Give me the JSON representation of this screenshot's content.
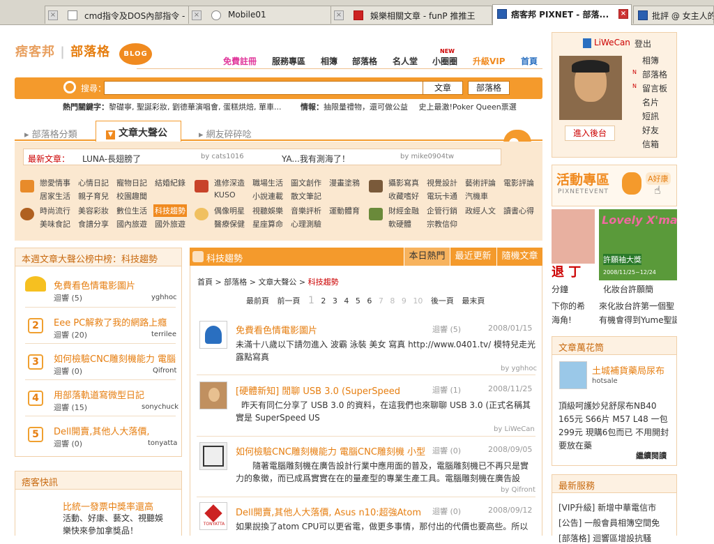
{
  "browser": {
    "tabs": [
      {
        "title": "cmd指令及DOS內部指令 - ..."
      },
      {
        "title": "Mobile01"
      },
      {
        "title": "娛樂相關文章 - funP 推推王"
      },
      {
        "title": "痞客邦 PIXNET - 部落..."
      },
      {
        "title": "批評 @ 女主人的"
      }
    ]
  },
  "header": {
    "logo_a": "痞客邦",
    "logo_b": "部落格",
    "logo_badge": "BLOG",
    "nav": [
      "免費註冊",
      "服務專區",
      "相簿",
      "部落格",
      "名人堂",
      "小圈圈",
      "升級VIP",
      "首頁"
    ],
    "new_badge": "NEW"
  },
  "search": {
    "label": "搜尋：",
    "btn_article": "文章",
    "btn_blog": "部落格",
    "hot_label": "熱門關鍵字：",
    "hot_text": "黎礎寧, 聖誕彩妝, 劉德華演唱會, 蛋糕烘焙, 單車...",
    "info_label": "情報：",
    "info_text": "抽限量禮物，還可做公益",
    "info_text2": "史上最激!Poker Queen票選"
  },
  "tabs2": [
    "部落格分類",
    "文章大聲公",
    "網友碎碎唸"
  ],
  "latest": {
    "label": "最新文章：",
    "item1": "LUNA-長翅膀了",
    "by1": "by cats1016",
    "item2": "YA...我有測海了！",
    "by2": "by mike0904tw"
  },
  "categories": {
    "g1": [
      "戀愛情事",
      "心情日記",
      "寵物日記",
      "結婚紀錄",
      "居家生活",
      "親子育兒",
      "校園趣聞"
    ],
    "g2": [
      "進修深造",
      "職場生活",
      "圖文創作",
      "漫畫塗鴉",
      "KUSO",
      "小說連載",
      "散文筆記"
    ],
    "g3": [
      "攝影寫真",
      "視覺設計",
      "藝術評論",
      "電影評論",
      "收藏嗜好",
      "電玩卡通",
      "汽機車"
    ],
    "g4": [
      "時尚流行",
      "美容彩妝",
      "數位生活",
      "科技趨勢",
      "美味食記",
      "食譜分享",
      "國內旅遊",
      "國外旅遊"
    ],
    "g5": [
      "偶像明星",
      "視聽娛樂",
      "音樂評析",
      "運動體育",
      "醫療保健",
      "星座算命",
      "心理測驗"
    ],
    "g6": [
      "財經金融",
      "企管行銷",
      "政經人文",
      "讀書心得",
      "軟硬體",
      "宗教信仰"
    ]
  },
  "weekly": {
    "title": "本週文章大聲公榜中榜：科技趨勢",
    "items": [
      {
        "rank": "1",
        "title": "免費看色情電影圖片",
        "sub": "迴響 (5)",
        "by": "yghhoc"
      },
      {
        "rank": "2",
        "title": "Eee PC解救了我的網路上癮",
        "sub": "迴響 (20)",
        "by": "terrilee"
      },
      {
        "rank": "3",
        "title": "如何檢驗CNC雕刻機能力 電腦",
        "sub": "迴響 (0)",
        "by": "Qifront"
      },
      {
        "rank": "4",
        "title": "用部落軌道寫微型日記",
        "sub": "迴響 (15)",
        "by": "sonychuck"
      },
      {
        "rank": "5",
        "title": "Dell開賣,其他人大落價,",
        "sub": "迴響 (0)",
        "by": "tonyatta"
      }
    ]
  },
  "quick": {
    "title": "痞客快訊",
    "line1": "比統一發票中獎率還高",
    "line2": "活動、好康、藝文、視聽娛",
    "line3": "樂快來參加拿獎品！"
  },
  "center": {
    "title": "科技趨勢",
    "tabs": [
      "本日熱門",
      "最近更新",
      "隨機文章"
    ],
    "crumb1": "首頁",
    "crumb2": "部落格",
    "crumb3": "文章大聲公",
    "crumb4": "科技趨勢",
    "page_first": "最前頁",
    "page_prev": "前一頁",
    "pages": [
      "1",
      "2",
      "3",
      "4",
      "5",
      "6",
      "7",
      "8",
      "9",
      "10"
    ],
    "page_next": "後一頁",
    "page_last": "最末頁",
    "posts": [
      {
        "title": "免費看色情電影圖片",
        "meta": "迴響 (5)",
        "date": "2008/01/15",
        "body": "未滿十八歲以下請勿進入 波霸 泳裝 美女 寫真 http://www.0401.tv/ 模特兒走光露點寫真",
        "by": "by yghhoc"
      },
      {
        "title": "[硬體新知] 閒聊 USB 3.0 (SuperSpeed",
        "meta": "迴響 (1)",
        "date": "2008/11/25",
        "body": "昨天有同仁分享了 USB 3.0 的資料，在這我們也來聊聊 USB 3.0 (正式名稱其實是 SuperSpeed US",
        "by": "by LiWeCan"
      },
      {
        "title": "如何檢驗CNC雕刻機能力 電腦CNC雕刻機 小型",
        "meta": "迴響 (0)",
        "date": "2008/09/05",
        "body": "隨著電腦雕刻機在廣告設計行業中應用面的普及，電腦雕刻機已不再只是實力的象徵，而已成爲實實在在的量產型的專業生產工具。電腦雕刻機在廣告設",
        "by": "by Qifront"
      },
      {
        "title": "Dell開賣,其他人大落價, Asus n10:超強Atom",
        "meta": "迴響 (0)",
        "date": "2008/09/12",
        "body": "如果說換了atom CPU可以更省電，做更多事情，那付出的代價也要高些。所以",
        "by": ""
      }
    ],
    "thumb4_label": "TONYATTA"
  },
  "user": {
    "name": "LiWeCan",
    "logout": "登出",
    "links": [
      "相簿",
      "部落格",
      "留言板",
      "名片",
      "短訊",
      "好友",
      "信箱"
    ],
    "backend": "進入後台"
  },
  "event": {
    "title": "活動專區",
    "sub": "PIXNETEVENT",
    "bubble": "A好康"
  },
  "promo": {
    "left_big": "退 丁",
    "left1": "分鐘",
    "left2": "下你的希",
    "left3": "海角!",
    "right_title": "Lovely X'mas",
    "right_sub": "許願袖大獎",
    "right_date": "2008/11/25~12/24",
    "right1": "化妝台許願簡",
    "right2": "來化妝台許第一個聖",
    "right3": "有機會得到Yume聖誕"
  },
  "article_flower": {
    "title": "文章萬花筒",
    "item_title": "土城補貨藥局尿布",
    "item_by": "hotsale",
    "body": "頂級呵護妙兒舒尿布NB40 165元 S66片 M57 L48 一包299元 現購6包而已 不用開封要放在藥",
    "more": "繼續閱讀"
  },
  "service": {
    "title": "最新服務",
    "items": [
      "[VIP升級] 新增中華電信市",
      "[公告] 一般會員相簿空間免",
      "[部落格] 迴響區增設抗騷"
    ]
  }
}
